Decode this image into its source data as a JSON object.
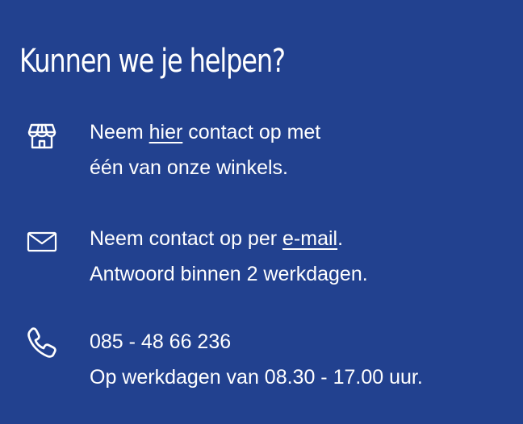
{
  "title": "Kunnen we je helpen?",
  "items": [
    {
      "icon": "store-icon",
      "line1": {
        "before": "Neem ",
        "link": "hier",
        "after": " contact op met"
      },
      "line2": "één van onze winkels."
    },
    {
      "icon": "mail-icon",
      "line1": {
        "before": "Neem contact op per ",
        "link": "e-mail",
        "after": "."
      },
      "line2": "Antwoord binnen 2 werkdagen."
    },
    {
      "icon": "phone-icon",
      "line1": "085 - 48 66 236",
      "line2": "Op werkdagen van 08.30 - 17.00 uur."
    }
  ],
  "colors": {
    "background": "#22418f",
    "text": "#ffffff"
  }
}
